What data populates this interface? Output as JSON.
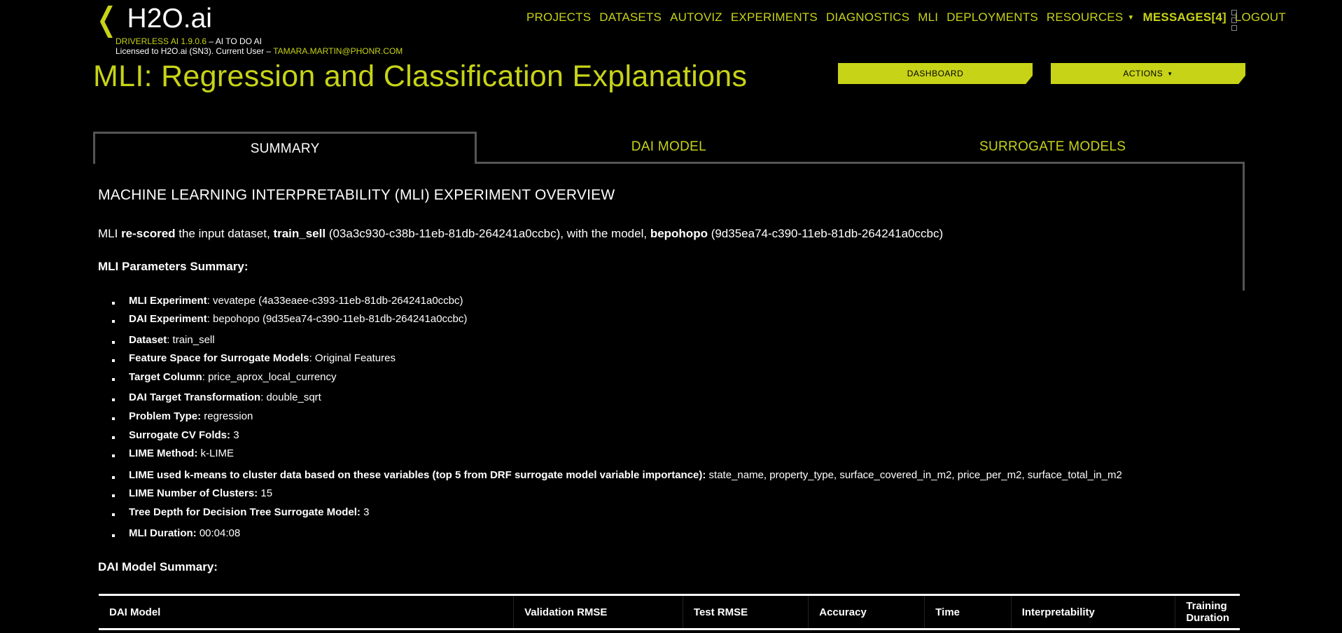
{
  "header": {
    "logo_chevron": "❬",
    "logo_text": "H2O.ai",
    "version_text": "DRIVERLESS AI 1.9.0.6",
    "version_sep": " – AI TO DO AI",
    "license_text": "Licensed to H2O.ai (SN3). Current User – ",
    "current_user": "TAMARA.MARTIN@PHONR.COM"
  },
  "nav": {
    "items": [
      "PROJECTS",
      "DATASETS",
      "AUTOVIZ",
      "EXPERIMENTS",
      "DIAGNOSTICS",
      "MLI",
      "DEPLOYMENTS"
    ],
    "resources": "RESOURCES",
    "messages": "MESSAGES[4]",
    "logout": "LOGOUT"
  },
  "page": {
    "title": "MLI: Regression and Classification Explanations",
    "dashboard_btn": "DASHBOARD",
    "actions_btn": "ACTIONS"
  },
  "tabs": [
    {
      "label": "SUMMARY",
      "active": true
    },
    {
      "label": "DAI MODEL",
      "active": false
    },
    {
      "label": "SURROGATE MODELS",
      "active": false
    }
  ],
  "summary": {
    "heading": "MACHINE LEARNING INTERPRETABILITY (MLI) EXPERIMENT OVERVIEW",
    "intro": {
      "p1": "MLI ",
      "rescored": "re-scored",
      "p2": " the input dataset, ",
      "dataset": "train_sell",
      "p3": " (03a3c930-c38b-11eb-81db-264241a0ccbc), with the model, ",
      "model": "bepohopo",
      "p4": " (9d35ea74-c390-11eb-81db-264241a0ccbc)"
    },
    "params_title": "MLI Parameters Summary:",
    "params": [
      {
        "label": "MLI Experiment",
        "sep": ": ",
        "value": "vevatepe (4a33eaee-c393-11eb-81db-264241a0ccbc)"
      },
      {
        "label": "DAI Experiment",
        "sep": ": ",
        "value": "bepohopo (9d35ea74-c390-11eb-81db-264241a0ccbc)"
      },
      {
        "label": "Dataset",
        "sep": ": ",
        "value": "train_sell"
      },
      {
        "label": "Feature Space for Surrogate Models",
        "sep": ": ",
        "value": "Original Features"
      },
      {
        "label": "Target Column",
        "sep": ": ",
        "value": "price_aprox_local_currency"
      },
      {
        "label": "DAI Target Transformation",
        "sep": ": ",
        "value": "double_sqrt"
      },
      {
        "label": "Problem Type:",
        "sep": " ",
        "value": "regression"
      },
      {
        "label": "Surrogate CV Folds:",
        "sep": " ",
        "value": "3"
      },
      {
        "label": "LIME Method:",
        "sep": " ",
        "value": "k-LIME"
      },
      {
        "label": "LIME used k-means to cluster data based on these variables (top 5 from DRF surrogate model variable importance):",
        "sep": " ",
        "value": "state_name, property_type, surface_covered_in_m2, price_per_m2, surface_total_in_m2"
      },
      {
        "label": "LIME Number of Clusters:",
        "sep": " ",
        "value": "15"
      },
      {
        "label": "Tree Depth for Decision Tree Surrogate Model:",
        "sep": " ",
        "value": "3"
      },
      {
        "label": "MLI Duration:",
        "sep": " ",
        "value": "00:04:08"
      }
    ],
    "dai_summary_title": "DAI Model Summary:",
    "table_headers": [
      "DAI Model",
      "Validation RMSE",
      "Test RMSE",
      "Accuracy",
      "Time",
      "Interpretability",
      "Training Duration"
    ]
  },
  "colors": {
    "accent": "#c7d317",
    "background": "#000000",
    "border": "#555555"
  }
}
